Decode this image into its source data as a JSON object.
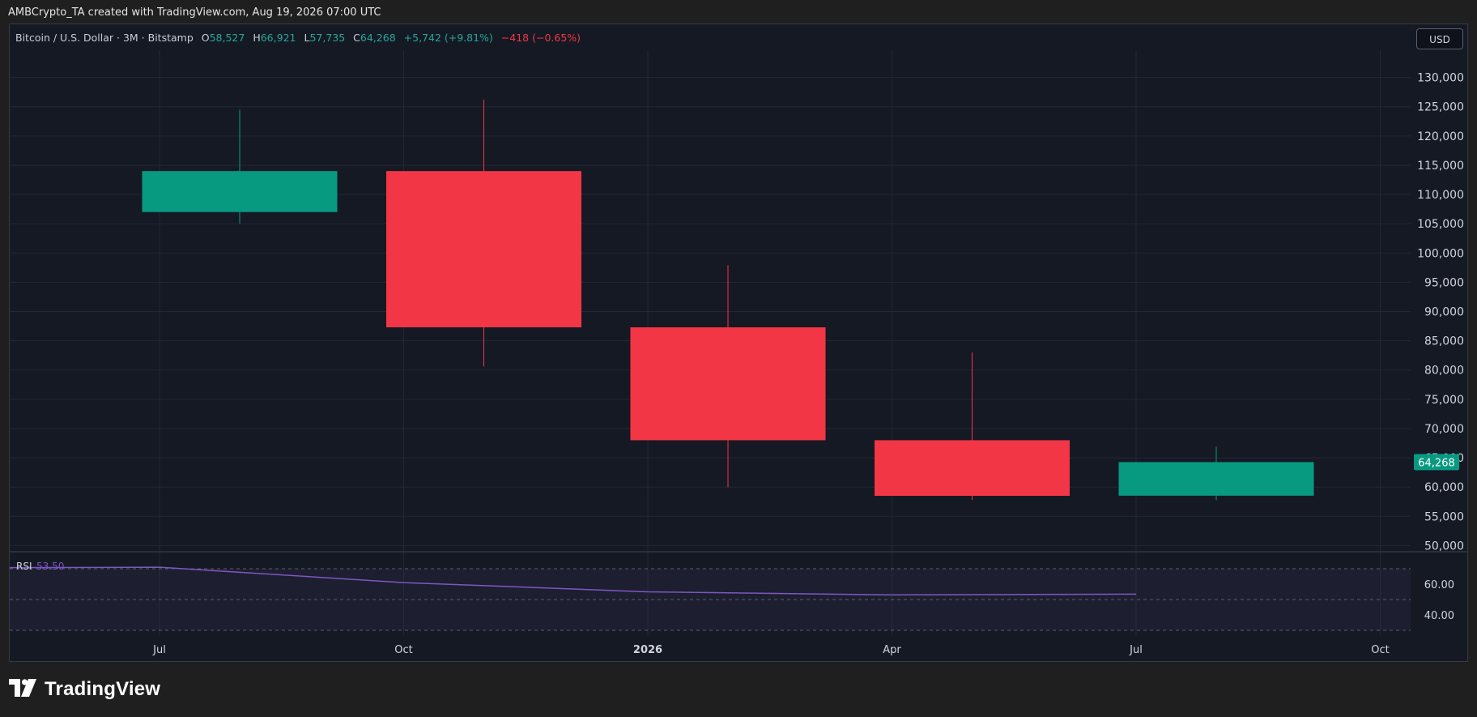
{
  "credit": "AMBCrypto_TA created with TradingView.com, Aug 19, 2026 07:00 UTC",
  "legend": {
    "symbol": "Bitcoin / U.S. Dollar · 3M · Bitstamp",
    "open_label": "O",
    "open": "58,527",
    "high_label": "H",
    "high": "66,921",
    "low_label": "L",
    "low": "57,735",
    "close_label": "C",
    "close": "64,268",
    "change": "+5,742 (+9.81%)",
    "change2": "−418 (−0.65%)"
  },
  "currency_button": "USD",
  "brand": {
    "name": "TradingView",
    "icon": "tradingview-logo-icon"
  },
  "colors": {
    "up": "#089981",
    "down": "#f23645",
    "rsi_line": "#7e57c2",
    "background": "#151924",
    "grid": "#232735"
  },
  "chart_data": {
    "type": "candlestick",
    "price_axis": {
      "ticks": [
        130000,
        125000,
        120000,
        115000,
        110000,
        105000,
        100000,
        95000,
        90000,
        85000,
        80000,
        75000,
        70000,
        65000,
        60000,
        55000,
        50000
      ],
      "tick_labels": [
        "130,000",
        "125,000",
        "120,000",
        "115,000",
        "110,000",
        "105,000",
        "100,000",
        "95,000",
        "90,000",
        "85,000",
        "80,000",
        "75,000",
        "70,000",
        "65,000",
        "60,000",
        "55,000",
        "50,000"
      ],
      "last_price_label": "64,268",
      "last_price": 64268
    },
    "time_axis": {
      "labels": [
        "Jul",
        "Oct",
        "2026",
        "Apr",
        "Jul",
        "Oct"
      ],
      "bold_label": "2026"
    },
    "candles": [
      {
        "period": "2025 Q3",
        "open": 107000,
        "high": 124500,
        "low": 105000,
        "close": 114000
      },
      {
        "period": "2025 Q4",
        "open": 114000,
        "high": 126200,
        "low": 80600,
        "close": 87300
      },
      {
        "period": "2026 Q1",
        "open": 87300,
        "high": 97900,
        "low": 60000,
        "close": 68000
      },
      {
        "period": "2026 Q2",
        "open": 68000,
        "high": 83000,
        "low": 57800,
        "close": 58500
      },
      {
        "period": "2026 Q3",
        "open": 58527,
        "high": 66921,
        "low": 57735,
        "close": 64268
      }
    ],
    "rsi": {
      "label": "RSI",
      "value_label": "53.50",
      "axis_ticks": [
        60,
        40
      ],
      "axis_tick_labels": [
        "60.00",
        "40.00"
      ],
      "bands": [
        70,
        50,
        30
      ],
      "values": [
        71,
        61,
        55,
        53,
        53.5
      ]
    }
  }
}
